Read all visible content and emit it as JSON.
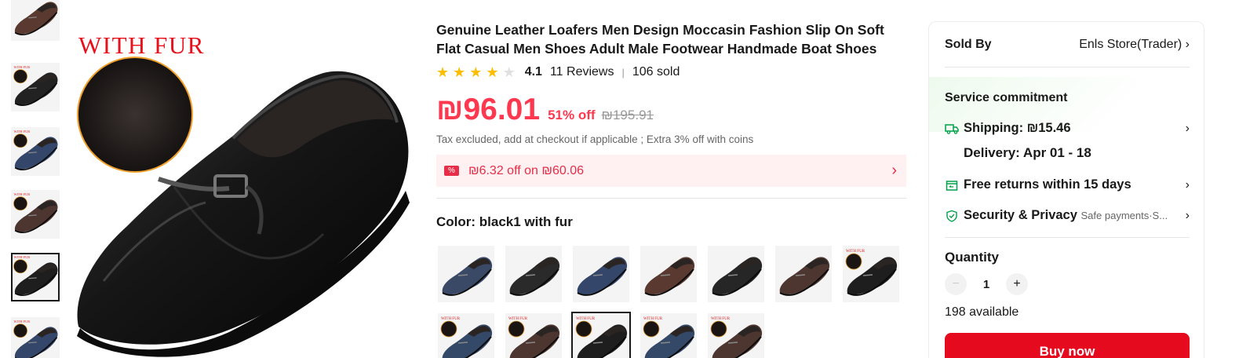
{
  "product": {
    "title": "Genuine Leather Loafers Men Design Moccasin Fashion Slip On Soft Flat Casual Men Shoes Adult Male Footwear Handmade Boat Shoes",
    "rating": "4.1",
    "rating_stars": 4,
    "reviews": "11 Reviews",
    "sold": "106 sold",
    "price": "₪96.01",
    "discount": "51% off",
    "original_price": "₪195.91",
    "tax_note": "Tax excluded, add at checkout if applicable ; Extra 3% off with coins",
    "coupon": {
      "icon": "percent-tag-icon",
      "text": "₪6.32 off on ₪60.06"
    },
    "color_label": "Color:",
    "color_value": "black1 with fur",
    "main_image_label": "WITH FUR",
    "swatches": [
      {
        "color": "#3a4a66",
        "fur": false,
        "selected": false
      },
      {
        "color": "#2a2a2a",
        "fur": false,
        "selected": false
      },
      {
        "color": "#34466a",
        "fur": false,
        "selected": false
      },
      {
        "color": "#5a3a30",
        "fur": false,
        "selected": false
      },
      {
        "color": "#262626",
        "fur": false,
        "selected": false
      },
      {
        "color": "#4e3630",
        "fur": false,
        "selected": false
      },
      {
        "color": "#1e1e1e",
        "fur": true,
        "selected": false
      },
      {
        "color": "#344868",
        "fur": true,
        "selected": false
      },
      {
        "color": "#4e3630",
        "fur": true,
        "selected": false
      },
      {
        "color": "#1e1e1e",
        "fur": true,
        "selected": true
      },
      {
        "color": "#344868",
        "fur": true,
        "selected": false
      },
      {
        "color": "#4e3630",
        "fur": true,
        "selected": false
      }
    ],
    "thumbnails": [
      {
        "color": "#5a3a30",
        "fur": false,
        "selected": false
      },
      {
        "color": "#222222",
        "fur": true,
        "selected": false
      },
      {
        "color": "#34466a",
        "fur": true,
        "selected": false
      },
      {
        "color": "#4e3630",
        "fur": true,
        "selected": false
      },
      {
        "color": "#1e1e1e",
        "fur": true,
        "selected": true
      },
      {
        "color": "#34466a",
        "fur": true,
        "selected": false
      }
    ]
  },
  "panel": {
    "sold_by_label": "Sold By",
    "store_name": "Enls Store(Trader)",
    "service_title": "Service commitment",
    "shipping": "Shipping: ₪15.46",
    "delivery": "Delivery: Apr 01 - 18",
    "free_returns": "Free returns within 15 days",
    "security": "Security & Privacy",
    "security_sub": "Safe payments·S...",
    "quantity_label": "Quantity",
    "quantity_value": "1",
    "available": "198 available",
    "buy_now": "Buy now"
  },
  "colors": {
    "price_red": "#fd384f",
    "buy_button": "#e60a1e",
    "star": "#fdbd00",
    "service_green": "#00a04a"
  }
}
